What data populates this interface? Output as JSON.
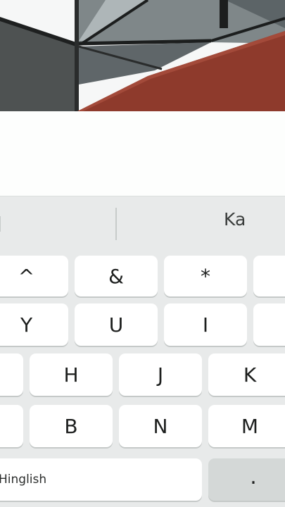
{
  "suggestions": {
    "left": "l",
    "right": "Ka"
  },
  "keyboard": {
    "symbol_row": [
      "^",
      "&",
      "*"
    ],
    "row_top": [
      "Y",
      "U",
      "I"
    ],
    "row_home": [
      "H",
      "J",
      "K"
    ],
    "row_bottom": [
      "B",
      "N",
      "M"
    ],
    "space_label": "Hinglish",
    "period_label": "."
  },
  "colors": {
    "keyboard_bg": "#e8eaea",
    "key_bg": "#ffffff",
    "gray_key_bg": "#d4d8d7",
    "photo_red_panel": "#8e3a2c"
  }
}
